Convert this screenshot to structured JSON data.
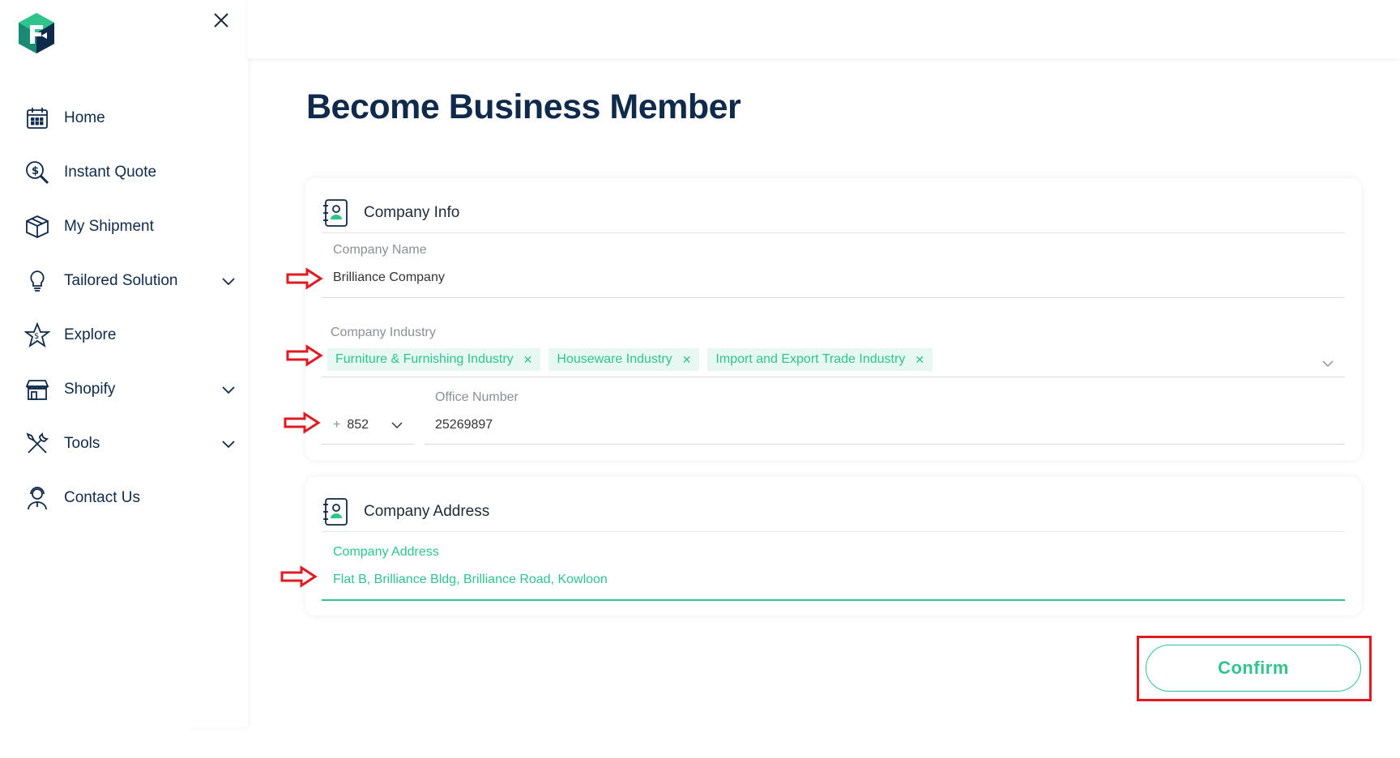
{
  "colors": {
    "brand_navy": "#0f2a4a",
    "accent_green": "#2ec48c",
    "tag_bg": "#e6f8f1",
    "annotation_red": "#e11a22"
  },
  "sidebar": {
    "logo_icon": "brand-logo",
    "close_icon": "close-icon",
    "items": [
      {
        "label": "Home",
        "icon": "calendar-icon",
        "has_chevron": false
      },
      {
        "label": "Instant Quote",
        "icon": "dollar-search-icon",
        "has_chevron": false
      },
      {
        "label": "My Shipment",
        "icon": "box-icon",
        "has_chevron": false
      },
      {
        "label": "Tailored Solution",
        "icon": "lightbulb-icon",
        "has_chevron": true
      },
      {
        "label": "Explore",
        "icon": "star-dollar-icon",
        "has_chevron": false
      },
      {
        "label": "Shopify",
        "icon": "store-icon",
        "has_chevron": true
      },
      {
        "label": "Tools",
        "icon": "tools-icon",
        "has_chevron": true
      },
      {
        "label": "Contact Us",
        "icon": "support-agent-icon",
        "has_chevron": false
      }
    ]
  },
  "page": {
    "title": "Become Business Member"
  },
  "company_info": {
    "title": "Company Info",
    "company_name": {
      "label": "Company Name",
      "value": "Brilliance Company"
    },
    "company_industry": {
      "label": "Company Industry",
      "tags": [
        "Furniture & Furnishing Industry",
        "Houseware Industry",
        "Import and Export Trade Industry"
      ]
    },
    "phone": {
      "country_code_prefix": "+",
      "country_code": "852",
      "label": "Office Number",
      "value": "25269897"
    }
  },
  "company_address": {
    "title": "Company Address",
    "label": "Company Address",
    "value": "Flat B, Brilliance Bldg, Brilliance Road, Kowloon"
  },
  "actions": {
    "confirm_label": "Confirm"
  }
}
